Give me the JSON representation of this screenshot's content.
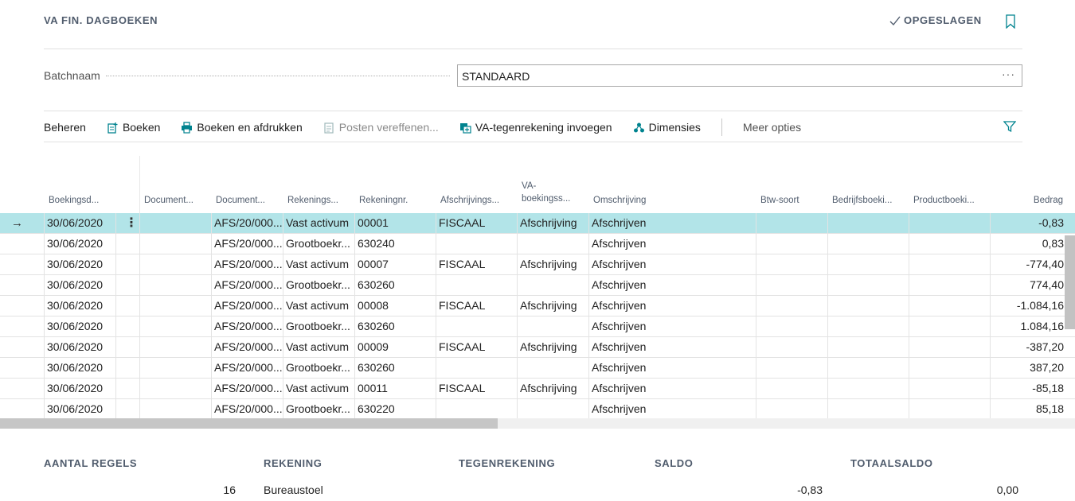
{
  "header": {
    "title": "VA FIN. DAGBOEKEN",
    "saved_label": "OPGESLAGEN"
  },
  "batch": {
    "label": "Batchnaam",
    "value": "STANDAARD",
    "more": "···"
  },
  "actions": {
    "beheren": "Beheren",
    "boeken": "Boeken",
    "boeken_afdrukken": "Boeken en afdrukken",
    "posten_vereffenen": "Posten vereffenen...",
    "va_tegenrekening": "VA-tegenrekening invoegen",
    "dimensies": "Dimensies",
    "meer_opties": "Meer opties"
  },
  "columns": {
    "boekingsdatum": "Boekingsd...",
    "documenttype": "Document...",
    "documentnr": "Document...",
    "rekeningsoort": "Rekenings...",
    "rekeningnr": "Rekeningnr.",
    "afschrijvingsboek": "Afschrijvings...",
    "va_boekingssoort_1": "VA-",
    "va_boekingssoort_2": "boekingss...",
    "omschrijving": "Omschrijving",
    "btw_soort": "Btw-soort",
    "bedrijfsboeking": "Bedrijfsboeki...",
    "productboeking": "Productboeki...",
    "bedrag": "Bedrag"
  },
  "rows": [
    {
      "date": "30/06/2020",
      "doctype": "",
      "docnr": "AFS/20/000...",
      "acctype": "Vast activum",
      "accnr": "00001",
      "depbook": "FISCAAL",
      "vatype": "Afschrijving",
      "desc": "Afschrijven",
      "amount": "-0,83",
      "selected": true
    },
    {
      "date": "30/06/2020",
      "doctype": "",
      "docnr": "AFS/20/000...",
      "acctype": "Grootboekr...",
      "accnr": "630240",
      "depbook": "",
      "vatype": "",
      "desc": "Afschrijven",
      "amount": "0,83"
    },
    {
      "date": "30/06/2020",
      "doctype": "",
      "docnr": "AFS/20/000...",
      "acctype": "Vast activum",
      "accnr": "00007",
      "depbook": "FISCAAL",
      "vatype": "Afschrijving",
      "desc": "Afschrijven",
      "amount": "-774,40"
    },
    {
      "date": "30/06/2020",
      "doctype": "",
      "docnr": "AFS/20/000...",
      "acctype": "Grootboekr...",
      "accnr": "630260",
      "depbook": "",
      "vatype": "",
      "desc": "Afschrijven",
      "amount": "774,40"
    },
    {
      "date": "30/06/2020",
      "doctype": "",
      "docnr": "AFS/20/000...",
      "acctype": "Vast activum",
      "accnr": "00008",
      "depbook": "FISCAAL",
      "vatype": "Afschrijving",
      "desc": "Afschrijven",
      "amount": "-1.084,16"
    },
    {
      "date": "30/06/2020",
      "doctype": "",
      "docnr": "AFS/20/000...",
      "acctype": "Grootboekr...",
      "accnr": "630260",
      "depbook": "",
      "vatype": "",
      "desc": "Afschrijven",
      "amount": "1.084,16"
    },
    {
      "date": "30/06/2020",
      "doctype": "",
      "docnr": "AFS/20/000...",
      "acctype": "Vast activum",
      "accnr": "00009",
      "depbook": "FISCAAL",
      "vatype": "Afschrijving",
      "desc": "Afschrijven",
      "amount": "-387,20"
    },
    {
      "date": "30/06/2020",
      "doctype": "",
      "docnr": "AFS/20/000...",
      "acctype": "Grootboekr...",
      "accnr": "630260",
      "depbook": "",
      "vatype": "",
      "desc": "Afschrijven",
      "amount": "387,20"
    },
    {
      "date": "30/06/2020",
      "doctype": "",
      "docnr": "AFS/20/000...",
      "acctype": "Vast activum",
      "accnr": "00011",
      "depbook": "FISCAAL",
      "vatype": "Afschrijving",
      "desc": "Afschrijven",
      "amount": "-85,18"
    },
    {
      "date": "30/06/2020",
      "doctype": "",
      "docnr": "AFS/20/000...",
      "acctype": "Grootboekr...",
      "accnr": "630220",
      "depbook": "",
      "vatype": "",
      "desc": "Afschrijven",
      "amount": "85,18"
    }
  ],
  "summary": {
    "aantal_regels_label": "AANTAL REGELS",
    "aantal_regels": "16",
    "rekening_label": "REKENING",
    "rekening": "Bureaustoel",
    "tegenrekening_label": "TEGENREKENING",
    "saldo_label": "SALDO",
    "saldo": "-0,83",
    "totaalsaldo_label": "TOTAALSALDO",
    "totaalsaldo": "0,00"
  },
  "colors": {
    "accent": "#00838f",
    "selected_row": "#b2e4e8"
  }
}
